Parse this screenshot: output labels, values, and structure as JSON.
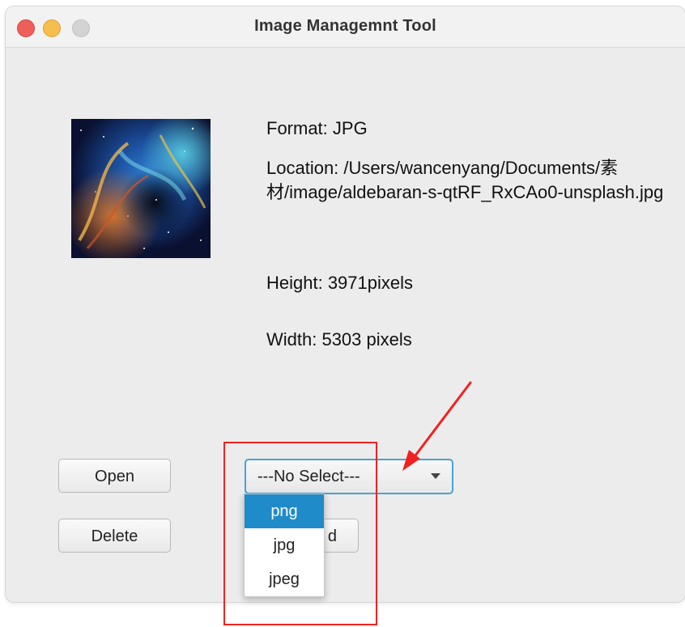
{
  "window": {
    "title": "Image Managemnt Tool"
  },
  "info": {
    "format": "Format: JPG",
    "location": "Location: /Users/wancenyang/Documents/素材/image/aldebaran-s-qtRF_RxCAo0-unsplash.jpg",
    "height": "Height: 3971pixels",
    "width": "Width: 5303 pixels"
  },
  "buttons": {
    "open_label": "Open",
    "delete_label": "Delete",
    "obscured_label_fragment": "d"
  },
  "format_select": {
    "value": "---No Select---",
    "options": [
      "png",
      "jpg",
      "jpeg"
    ],
    "highlighted_option": "png"
  },
  "colors": {
    "window_bg": "#ececec",
    "focus_ring": "#4aa0d8",
    "selection": "#1f8bc9",
    "annotation": "#f22121"
  },
  "icons": {
    "close": "traffic-light-close",
    "minimize": "traffic-light-minimize",
    "maximize": "traffic-light-maximize",
    "dropdown": "chevron-down"
  }
}
